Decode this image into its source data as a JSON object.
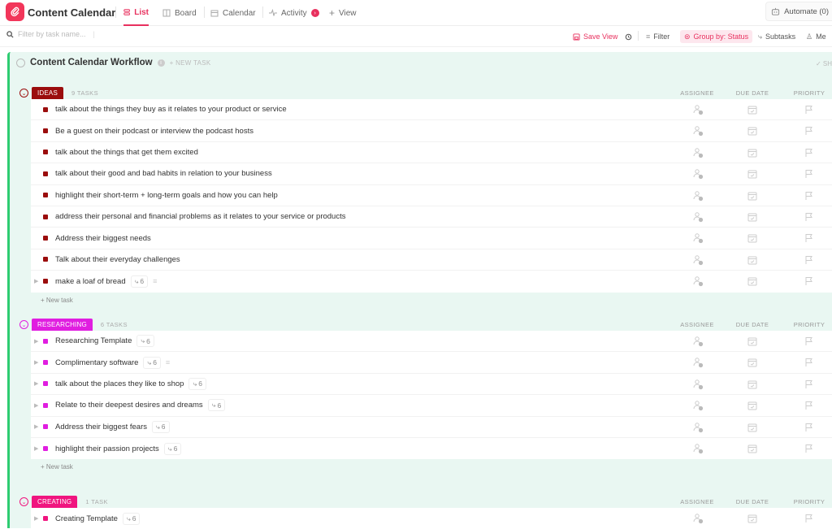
{
  "app": {
    "title": "Content Calendar",
    "brand_color": "#f2365a",
    "accent": "#e8305e"
  },
  "tabs": [
    {
      "label": "List",
      "active": true,
      "icon": "list-icon"
    },
    {
      "label": "Board",
      "active": false,
      "icon": "board-icon"
    },
    {
      "label": "Calendar",
      "active": false,
      "icon": "calendar-icon"
    },
    {
      "label": "Activity",
      "active": false,
      "icon": "activity-icon"
    },
    {
      "label": "View",
      "active": false,
      "icon": "plus-icon"
    }
  ],
  "automate_label": "Automate (0)",
  "toolbar": {
    "filter_placeholder": "Filter by task name...",
    "save_view": "Save View",
    "filter": "Filter",
    "group_by": "Group by: Status",
    "subtasks": "Subtasks",
    "me": "Me"
  },
  "list": {
    "title": "Content Calendar Workflow",
    "new_task": "+ NEW TASK",
    "show": "✓ SH"
  },
  "columns": {
    "assignee": "ASSIGNEE",
    "due_date": "DUE DATE",
    "priority": "PRIORITY"
  },
  "new_task_label": "+ New task",
  "groups": [
    {
      "name": "IDEAS",
      "count": "9 TASKS",
      "color": "#9b0d0d",
      "tasks": [
        {
          "name": "talk about the things they buy as it relates to your product or service"
        },
        {
          "name": "Be a guest on their podcast or interview the podcast hosts"
        },
        {
          "name": "talk about the things that get them excited"
        },
        {
          "name": "talk about their good and bad habits in relation to your business"
        },
        {
          "name": "highlight their short-term + long-term goals and how you can help"
        },
        {
          "name": "address their personal and financial problems as it relates to your service or products"
        },
        {
          "name": "Address their biggest needs"
        },
        {
          "name": "Talk about their everyday challenges"
        },
        {
          "name": "make a loaf of bread",
          "subtasks": "6",
          "has_desc": true,
          "expandable": true
        }
      ]
    },
    {
      "name": "RESEARCHING",
      "count": "6 TASKS",
      "color": "#e01ee0",
      "tasks": [
        {
          "name": "Researching Template",
          "subtasks": "6",
          "expandable": true
        },
        {
          "name": "Complimentary software",
          "subtasks": "6",
          "has_desc": true,
          "expandable": true
        },
        {
          "name": "talk about the places they like to shop",
          "subtasks": "6",
          "expandable": true
        },
        {
          "name": "Relate to their deepest desires and dreams",
          "subtasks": "6",
          "expandable": true
        },
        {
          "name": "Address their biggest fears",
          "subtasks": "6",
          "expandable": true
        },
        {
          "name": "highlight their passion projects",
          "subtasks": "6",
          "expandable": true
        }
      ]
    },
    {
      "name": "CREATING",
      "count": "1 TASK",
      "color": "#f0157f",
      "tasks": [
        {
          "name": "Creating Template",
          "subtasks": "6",
          "expandable": true
        }
      ]
    }
  ]
}
